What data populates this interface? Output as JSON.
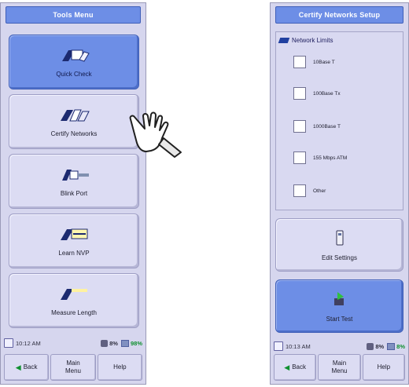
{
  "left_screen": {
    "title": "Tools Menu",
    "buttons": [
      {
        "label": "Quick Check",
        "icon": "quick-check-icon",
        "active": true
      },
      {
        "label": "Certify Networks",
        "icon": "certify-networks-icon",
        "active": false
      },
      {
        "label": "Blink Port",
        "icon": "blink-port-icon",
        "active": false
      },
      {
        "label": "Learn NVP",
        "icon": "learn-nvp-icon",
        "active": false
      },
      {
        "label": "Measure Length",
        "icon": "measure-length-icon",
        "active": false
      }
    ],
    "status": {
      "time": "10:12 AM",
      "battery": "8%",
      "memory": "98%"
    },
    "nav": {
      "back": "Back",
      "main_menu": "Main Menu",
      "help": "Help"
    }
  },
  "right_screen": {
    "title": "Certify Networks Setup",
    "section_label": "Network Limits",
    "options": [
      "10Base T",
      "100Base Tx",
      "1000Base T",
      "155 Mbps ATM",
      "Other"
    ],
    "edit_label": "Edit Settings",
    "start_label": "Start Test",
    "status": {
      "time": "10:13 AM",
      "battery": "8%",
      "memory": "8%"
    },
    "nav": {
      "back": "Back",
      "main_menu": "Main Menu",
      "help": "Help"
    }
  },
  "colors": {
    "accent": "#6d8ee6",
    "panel": "#d6d6ee",
    "ok": "#109030"
  },
  "pointer_icon": "hand-pointer-icon"
}
